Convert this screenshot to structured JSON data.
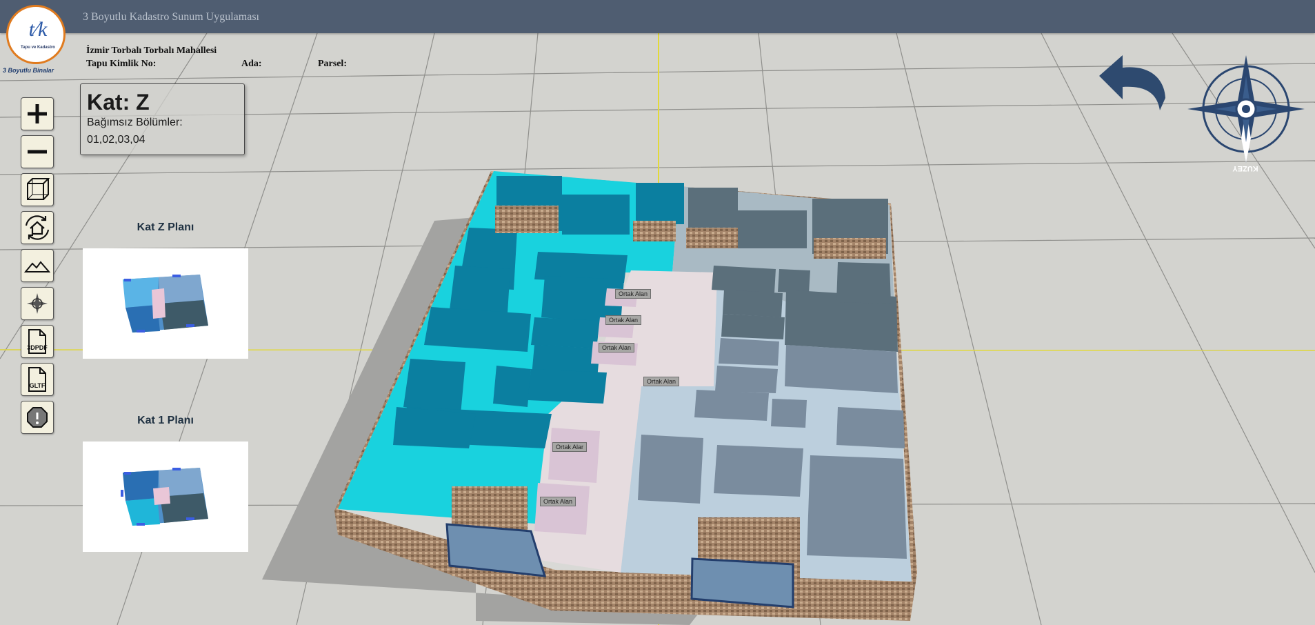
{
  "app": {
    "title": "3 Boyutlu Kadastro Sunum Uygulaması"
  },
  "logo": {
    "text": "Tapu ve Kadastro",
    "sub": "3 Boyutlu Binalar"
  },
  "parcel": {
    "location": "İzmir Torbalı Torbalı Mahallesi",
    "tapu_label": "Tapu Kimlik No:",
    "ada_label": "Ada:",
    "parsel_label": "Parsel:"
  },
  "floor_info": {
    "title": "Kat: Z",
    "units_label": "Bağımsız Bölümler:",
    "units_value": "01,02,03,04"
  },
  "toolbar": [
    {
      "name": "zoom-in-button",
      "icon": "plus-icon"
    },
    {
      "name": "zoom-out-button",
      "icon": "minus-icon"
    },
    {
      "name": "cube-view-button",
      "icon": "cube-icon"
    },
    {
      "name": "rotate-building-button",
      "icon": "home-rotate-icon"
    },
    {
      "name": "terrain-button",
      "icon": "mountain-icon"
    },
    {
      "name": "compass-button",
      "icon": "compass-icon"
    },
    {
      "name": "export-3dpdf-button",
      "icon": "file-icon",
      "label": "3DPDF"
    },
    {
      "name": "export-gltf-button",
      "icon": "file-icon",
      "label": "GLTF"
    },
    {
      "name": "warning-button",
      "icon": "alert-octagon-icon"
    }
  ],
  "plans": [
    {
      "title": "Kat Z Planı"
    },
    {
      "title": "Kat 1 Planı"
    }
  ],
  "scene_labels": {
    "common_area": "Ortak Alan",
    "common_area_short": "Ortak Alar"
  },
  "compass": {
    "label": "KUZEY"
  },
  "colors": {
    "topbar": "#4f5d71",
    "unit_cyan": "#1ad3df",
    "unit_teal": "#0b7fa0",
    "unit_slate": "#5e7280",
    "unit_lightblue": "#b9ccdc",
    "common_pink": "#e2cfdc",
    "brick": "#9b7d62",
    "arrow": "#2e4a6f"
  }
}
